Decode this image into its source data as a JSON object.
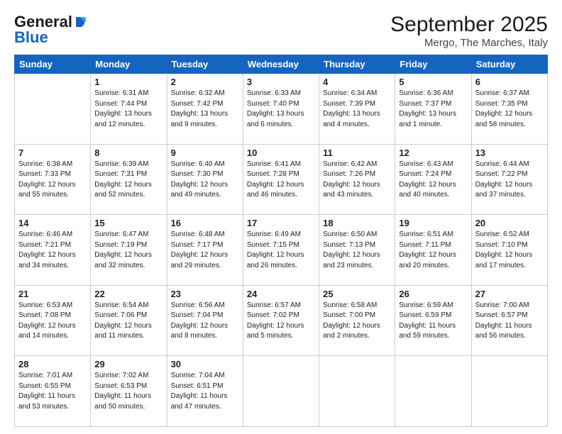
{
  "header": {
    "logo_general": "General",
    "logo_blue": "Blue",
    "month_title": "September 2025",
    "location": "Mergo, The Marches, Italy"
  },
  "weekdays": [
    "Sunday",
    "Monday",
    "Tuesday",
    "Wednesday",
    "Thursday",
    "Friday",
    "Saturday"
  ],
  "weeks": [
    [
      {
        "day": "",
        "info": ""
      },
      {
        "day": "1",
        "info": "Sunrise: 6:31 AM\nSunset: 7:44 PM\nDaylight: 13 hours\nand 12 minutes."
      },
      {
        "day": "2",
        "info": "Sunrise: 6:32 AM\nSunset: 7:42 PM\nDaylight: 13 hours\nand 9 minutes."
      },
      {
        "day": "3",
        "info": "Sunrise: 6:33 AM\nSunset: 7:40 PM\nDaylight: 13 hours\nand 6 minutes."
      },
      {
        "day": "4",
        "info": "Sunrise: 6:34 AM\nSunset: 7:39 PM\nDaylight: 13 hours\nand 4 minutes."
      },
      {
        "day": "5",
        "info": "Sunrise: 6:36 AM\nSunset: 7:37 PM\nDaylight: 13 hours\nand 1 minute."
      },
      {
        "day": "6",
        "info": "Sunrise: 6:37 AM\nSunset: 7:35 PM\nDaylight: 12 hours\nand 58 minutes."
      }
    ],
    [
      {
        "day": "7",
        "info": "Sunrise: 6:38 AM\nSunset: 7:33 PM\nDaylight: 12 hours\nand 55 minutes."
      },
      {
        "day": "8",
        "info": "Sunrise: 6:39 AM\nSunset: 7:31 PM\nDaylight: 12 hours\nand 52 minutes."
      },
      {
        "day": "9",
        "info": "Sunrise: 6:40 AM\nSunset: 7:30 PM\nDaylight: 12 hours\nand 49 minutes."
      },
      {
        "day": "10",
        "info": "Sunrise: 6:41 AM\nSunset: 7:28 PM\nDaylight: 12 hours\nand 46 minutes."
      },
      {
        "day": "11",
        "info": "Sunrise: 6:42 AM\nSunset: 7:26 PM\nDaylight: 12 hours\nand 43 minutes."
      },
      {
        "day": "12",
        "info": "Sunrise: 6:43 AM\nSunset: 7:24 PM\nDaylight: 12 hours\nand 40 minutes."
      },
      {
        "day": "13",
        "info": "Sunrise: 6:44 AM\nSunset: 7:22 PM\nDaylight: 12 hours\nand 37 minutes."
      }
    ],
    [
      {
        "day": "14",
        "info": "Sunrise: 6:46 AM\nSunset: 7:21 PM\nDaylight: 12 hours\nand 34 minutes."
      },
      {
        "day": "15",
        "info": "Sunrise: 6:47 AM\nSunset: 7:19 PM\nDaylight: 12 hours\nand 32 minutes."
      },
      {
        "day": "16",
        "info": "Sunrise: 6:48 AM\nSunset: 7:17 PM\nDaylight: 12 hours\nand 29 minutes."
      },
      {
        "day": "17",
        "info": "Sunrise: 6:49 AM\nSunset: 7:15 PM\nDaylight: 12 hours\nand 26 minutes."
      },
      {
        "day": "18",
        "info": "Sunrise: 6:50 AM\nSunset: 7:13 PM\nDaylight: 12 hours\nand 23 minutes."
      },
      {
        "day": "19",
        "info": "Sunrise: 6:51 AM\nSunset: 7:11 PM\nDaylight: 12 hours\nand 20 minutes."
      },
      {
        "day": "20",
        "info": "Sunrise: 6:52 AM\nSunset: 7:10 PM\nDaylight: 12 hours\nand 17 minutes."
      }
    ],
    [
      {
        "day": "21",
        "info": "Sunrise: 6:53 AM\nSunset: 7:08 PM\nDaylight: 12 hours\nand 14 minutes."
      },
      {
        "day": "22",
        "info": "Sunrise: 6:54 AM\nSunset: 7:06 PM\nDaylight: 12 hours\nand 11 minutes."
      },
      {
        "day": "23",
        "info": "Sunrise: 6:56 AM\nSunset: 7:04 PM\nDaylight: 12 hours\nand 8 minutes."
      },
      {
        "day": "24",
        "info": "Sunrise: 6:57 AM\nSunset: 7:02 PM\nDaylight: 12 hours\nand 5 minutes."
      },
      {
        "day": "25",
        "info": "Sunrise: 6:58 AM\nSunset: 7:00 PM\nDaylight: 12 hours\nand 2 minutes."
      },
      {
        "day": "26",
        "info": "Sunrise: 6:59 AM\nSunset: 6:59 PM\nDaylight: 11 hours\nand 59 minutes."
      },
      {
        "day": "27",
        "info": "Sunrise: 7:00 AM\nSunset: 6:57 PM\nDaylight: 11 hours\nand 56 minutes."
      }
    ],
    [
      {
        "day": "28",
        "info": "Sunrise: 7:01 AM\nSunset: 6:55 PM\nDaylight: 11 hours\nand 53 minutes."
      },
      {
        "day": "29",
        "info": "Sunrise: 7:02 AM\nSunset: 6:53 PM\nDaylight: 11 hours\nand 50 minutes."
      },
      {
        "day": "30",
        "info": "Sunrise: 7:04 AM\nSunset: 6:51 PM\nDaylight: 11 hours\nand 47 minutes."
      },
      {
        "day": "",
        "info": ""
      },
      {
        "day": "",
        "info": ""
      },
      {
        "day": "",
        "info": ""
      },
      {
        "day": "",
        "info": ""
      }
    ]
  ]
}
